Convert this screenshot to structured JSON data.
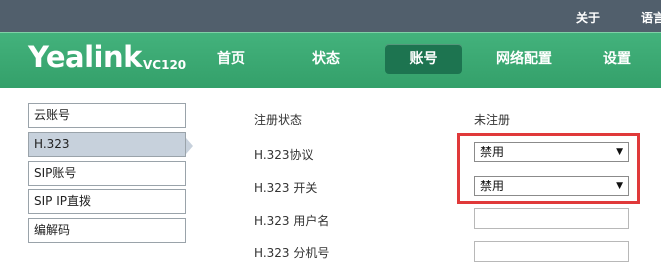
{
  "top_links": {
    "about": "关于",
    "language": "语言"
  },
  "brand": {
    "logo": "Yealink",
    "model": "VC120"
  },
  "nav": {
    "home": "首页",
    "status": "状态",
    "account": "账号",
    "network": "网络配置",
    "settings": "设置"
  },
  "sidebar": {
    "items": [
      {
        "label": "云账号"
      },
      {
        "label": "H.323"
      },
      {
        "label": "SIP账号"
      },
      {
        "label": "SIP IP直拨"
      },
      {
        "label": "编解码"
      }
    ]
  },
  "form": {
    "register_status": {
      "label": "注册状态",
      "value": "未注册"
    },
    "h323_protocol": {
      "label": "H.323协议",
      "value": "禁用"
    },
    "h323_switch": {
      "label": "H.323 开关",
      "value": "禁用"
    },
    "h323_username": {
      "label": "H.323 用户名",
      "value": ""
    },
    "h323_extension": {
      "label": "H.323 分机号",
      "value": ""
    }
  },
  "icons": {
    "dropdown": "chevron-down-icon",
    "selected_pointer": "triangle-right-icon"
  },
  "colors": {
    "topbar": "#515f6c",
    "nav": "#3aa872",
    "nav_active": "#1d7450",
    "sidebar_selected": "#c7d1dc",
    "highlight": "#e0393a"
  }
}
